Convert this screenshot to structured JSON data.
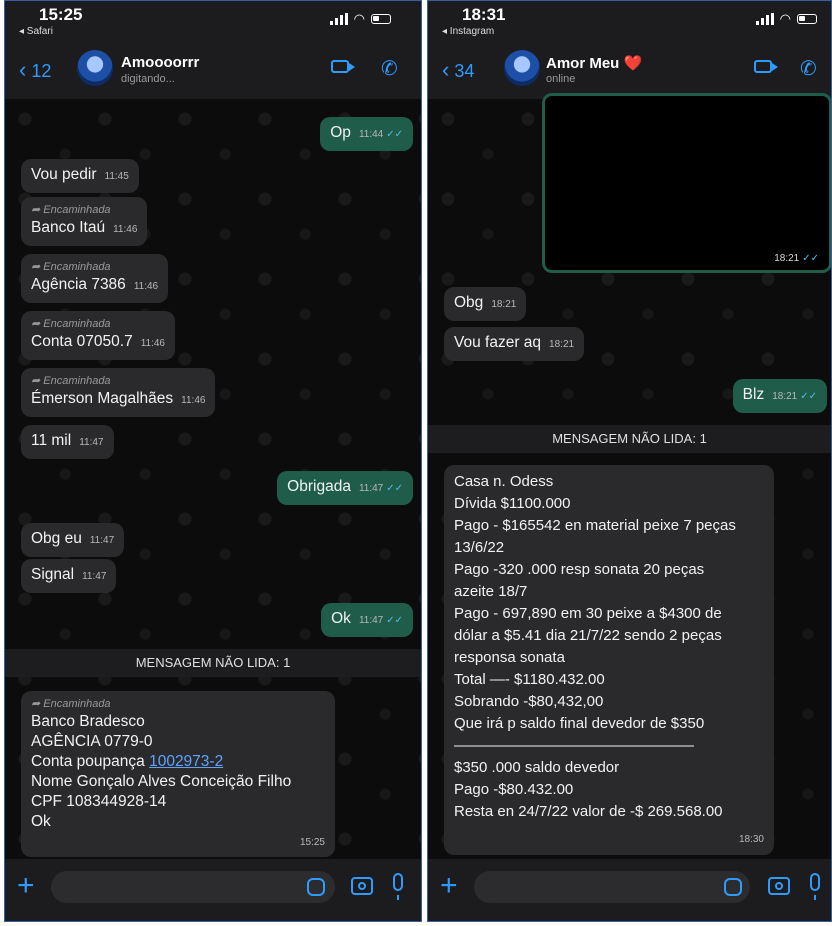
{
  "left": {
    "status": {
      "time": "15:25",
      "back_app": "◂ Safari"
    },
    "header": {
      "back_count": "12",
      "name": "Amoooorrr",
      "subtitle": "digitando..."
    },
    "messages": [
      {
        "text": "Op",
        "time": "11:44"
      },
      {
        "text": "Vou pedir",
        "time": "11:45"
      },
      {
        "fwd": "Encaminhada",
        "text": "Banco Itaú",
        "time": "11:46"
      },
      {
        "fwd": "Encaminhada",
        "text": "Agência 7386",
        "time": "11:46"
      },
      {
        "fwd": "Encaminhada",
        "text": "Conta 07050.7",
        "time": "11:46"
      },
      {
        "fwd": "Encaminhada",
        "text": "Émerson Magalhães",
        "time": "11:46"
      },
      {
        "text": "11 mil",
        "time": "11:47"
      },
      {
        "text": "Obrigada",
        "time": "11:47"
      },
      {
        "text": "Obg eu",
        "time": "11:47"
      },
      {
        "text": "Signal",
        "time": "11:47"
      },
      {
        "text": "Ok",
        "time": "11:47"
      }
    ],
    "unread": "MENSAGEM NÃO LIDA: 1",
    "last": {
      "fwd": "Encaminhada",
      "lines": [
        "Banco Bradesco",
        "AGÊNCIA 0779-0",
        "Conta poupança ",
        "Nome Gonçalo Alves Conceição Filho",
        "CPF 108344928-14",
        "Ok"
      ],
      "link": "1002973-2",
      "time": "15:25"
    }
  },
  "right": {
    "status": {
      "time": "18:31",
      "back_app": "◂ Instagram"
    },
    "header": {
      "back_count": "34",
      "name": "Amor Meu",
      "heart": "❤️",
      "subtitle": "online"
    },
    "image_time": "18:21",
    "messages": [
      {
        "text": "Obg",
        "time": "18:21"
      },
      {
        "text": "Vou fazer aq",
        "time": "18:21"
      },
      {
        "text": "Blz",
        "time": "18:21"
      }
    ],
    "unread": "MENSAGEM NÃO LIDA: 1",
    "last": {
      "lines": [
        "Casa n. Odess",
        "Dívida $1100.000",
        "Pago - $165542 en material peixe 7 peças",
        "13/6/22",
        "Pago -320 .000 resp sonata 20 peças",
        "azeite 18/7",
        "Pago - 697,890 em 30 peixe a $4300 de",
        "dólar a $5.41 dia 21/7/22 sendo 2 peças",
        "responsa sonata",
        "Total —- $1180.432.00",
        "Sobrando -$80,432,00",
        "Que irá p saldo final devedor de $350",
        "————————————————",
        "$350 .000 saldo devedor",
        "Pago -$80.432.00",
        "Resta en 24/7/22 valor de -$ 269.568.00"
      ],
      "time": "18:30"
    }
  },
  "colors": {
    "accent": "#2e9bff",
    "outgoing": "#1f5c4a",
    "incoming": "#2a2a2c",
    "read_ticks": "#53bdeb"
  }
}
